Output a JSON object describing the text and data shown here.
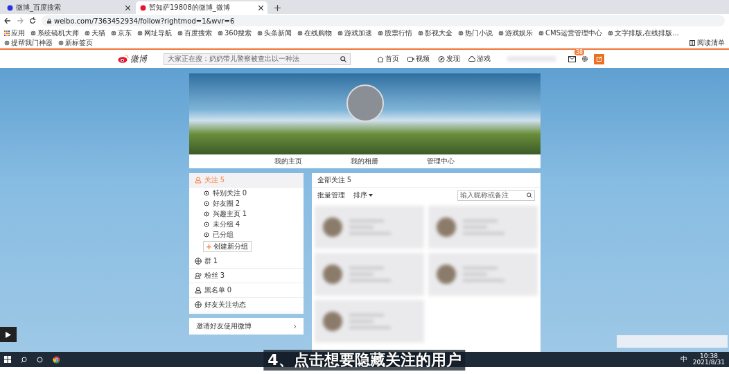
{
  "browser": {
    "tabs": [
      {
        "title": "微博_百度搜索",
        "selected": false
      },
      {
        "title": "暂知萨19808的微博_微博",
        "selected": true
      }
    ],
    "url": "weibo.com/7363452934/follow?rightmod=1&wvr=6",
    "bookmarks": [
      "应用",
      "系统镜机大师",
      "天猫",
      "京东",
      "网址导航",
      "百度搜索",
      "360搜索",
      "头条新闻",
      "在线购物",
      "游戏加速",
      "股票行情",
      "影视大全",
      "热门小说",
      "游戏娱乐",
      "CMS运营管理中心",
      "文字排版,在线排版...",
      "提帮我门神器",
      "新标签页"
    ],
    "reading_list": "阅读清单"
  },
  "weibo_header": {
    "logo": "微博",
    "search_placeholder": "大家正在搜：奶奶带儿警察被查出以一种法",
    "nav": [
      "首页",
      "视频",
      "发现",
      "游戏"
    ],
    "message_badge": "38"
  },
  "profile": {
    "tabs": [
      "我的主页",
      "我的相册",
      "管理中心"
    ]
  },
  "sidebar": {
    "items": [
      {
        "kind": "primary",
        "label": "关注",
        "count": "5",
        "selected": true
      },
      {
        "kind": "sub",
        "label": "特别关注",
        "count": "0",
        "selected": false
      },
      {
        "kind": "sub",
        "label": "好友圈",
        "count": "2",
        "selected": false
      },
      {
        "kind": "sub",
        "label": "兴趣主页",
        "count": "1",
        "selected": false
      },
      {
        "kind": "sub",
        "label": "未分组",
        "count": "4",
        "selected": false
      },
      {
        "kind": "sub",
        "label": "已分组",
        "selected": false
      },
      {
        "kind": "action",
        "label": "创建新分组"
      },
      {
        "kind": "primary",
        "label": "群",
        "count": "1",
        "selected": false
      },
      {
        "kind": "primary",
        "label": "粉丝",
        "count": "3",
        "selected": false
      },
      {
        "kind": "primary",
        "label": "黑名单",
        "count": "0",
        "selected": false
      },
      {
        "kind": "primary",
        "label": "好友关注动态",
        "selected": false
      }
    ],
    "invite": "邀请好友使用微博"
  },
  "follow_panel": {
    "title": "全部关注",
    "count": "5",
    "manage": "批量管理",
    "sort": "排序",
    "search_placeholder": "输入昵称或备注"
  },
  "caption": "4、点击想要隐藏关注的用户",
  "taskbar": {
    "ime": "中",
    "time": "10:38",
    "date": "2021/8/31"
  }
}
